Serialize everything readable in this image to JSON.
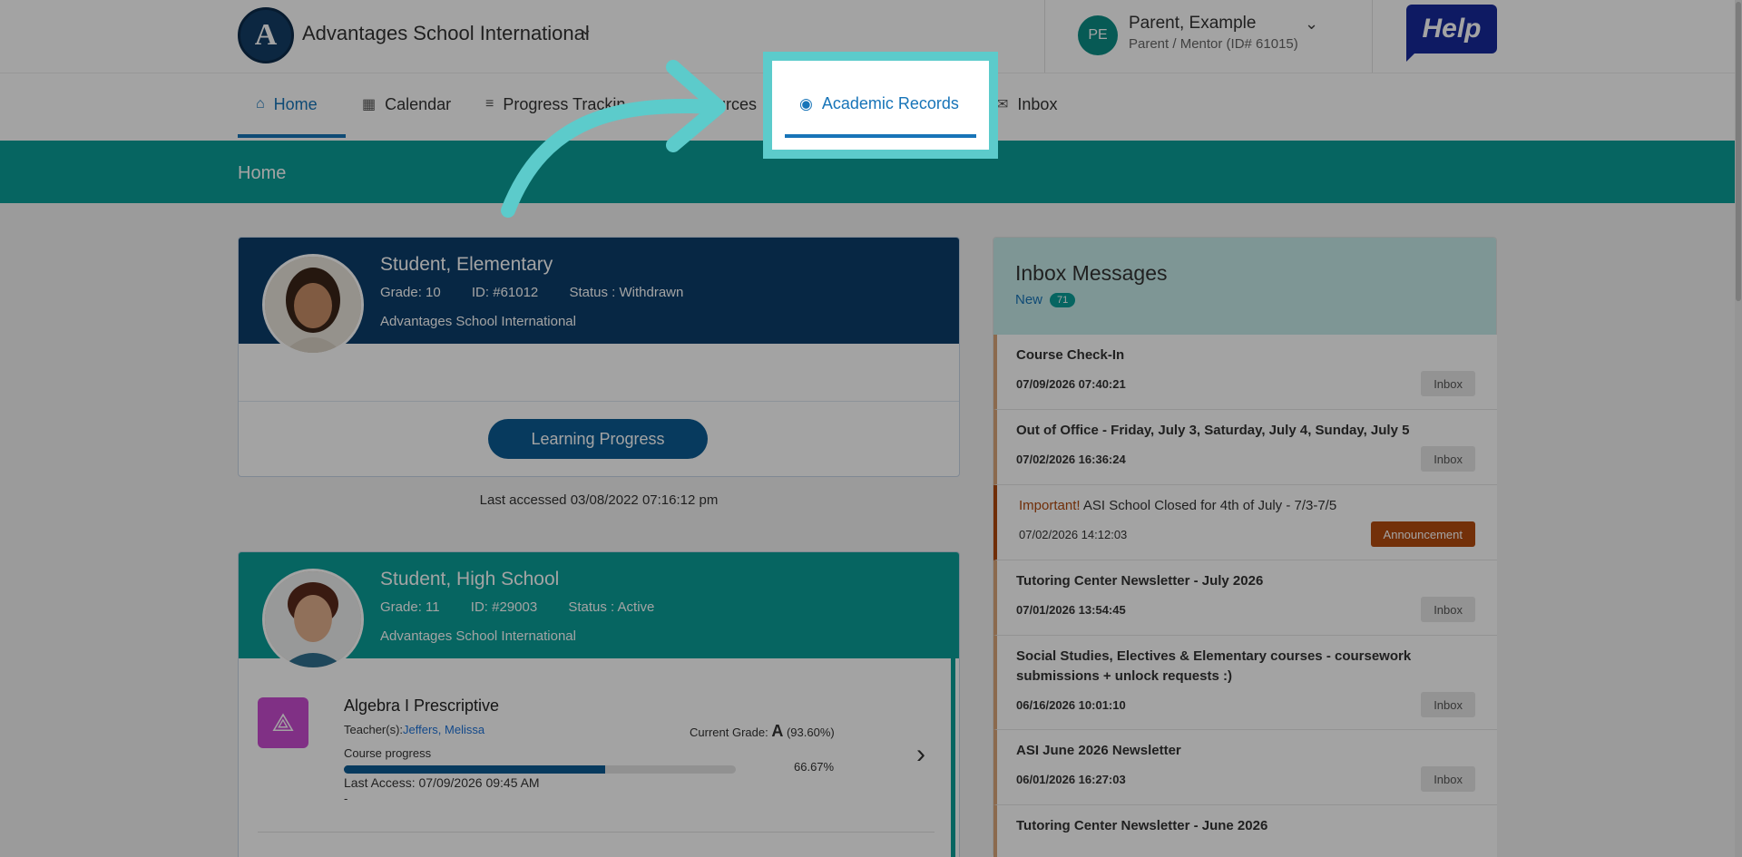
{
  "header": {
    "school_logo_letter": "A",
    "school_name": "Advantages School International",
    "user_initials": "PE",
    "user_name": "Parent, Example",
    "user_role": "Parent / Mentor (ID# 61015)",
    "help_label": "Help"
  },
  "nav": {
    "items": [
      {
        "label": "Home",
        "icon": "home-icon"
      },
      {
        "label": "Calendar",
        "icon": "calendar-icon"
      },
      {
        "label": "Progress Trackin",
        "icon": "progress-icon"
      },
      {
        "label": "ources",
        "icon": ""
      },
      {
        "label": "Academic Records",
        "icon": "user-circle-icon"
      },
      {
        "label": "Inbox",
        "icon": "mail-icon"
      }
    ],
    "active": "Home",
    "highlighted": "Academic Records"
  },
  "banner": {
    "title": "Home"
  },
  "students": [
    {
      "name": "Student, Elementary",
      "grade": "Grade: 10",
      "id": "ID: #61012",
      "status": "Status :  Withdrawn",
      "school": "Advantages School International",
      "header_color": "#0b3d6b",
      "button_label": "Learning Progress",
      "last_accessed": "Last accessed 03/08/2022 07:16:12 pm"
    },
    {
      "name": "Student, High School",
      "grade": "Grade: 11",
      "id": "ID: #29003",
      "status": "Status :  Active",
      "school": "Advantages School International",
      "header_color": "#0a9e98",
      "course": {
        "name": "Algebra I Prescriptive",
        "teacher_label": "Teacher(s):",
        "teacher_name": "Jeffers, Melissa",
        "grade_label": "Current Grade:",
        "grade_letter": "A",
        "grade_pct": "(93.60%)",
        "progress_label": "Course progress",
        "progress_value": 0.6667,
        "progress_text": "66.67%",
        "last_access": "Last Access: 07/09/2026 09:45 AM",
        "dash": "-"
      }
    }
  ],
  "inbox": {
    "title": "Inbox Messages",
    "new_label": "New",
    "new_count": "71",
    "messages": [
      {
        "title": "Course Check-In",
        "date": "07/09/2026 07:40:21",
        "badge": "Inbox"
      },
      {
        "title": "Out of Office - Friday, July 3, Saturday, July 4, Sunday, July 5",
        "date": "07/02/2026 16:36:24",
        "badge": "Inbox"
      },
      {
        "important": "Important!",
        "title": " ASI School Closed for 4th of July - 7/3-7/5",
        "date": "07/02/2026 14:12:03",
        "badge": "Announcement"
      },
      {
        "title": "Tutoring Center Newsletter - July 2026",
        "date": "07/01/2026 13:54:45",
        "badge": "Inbox"
      },
      {
        "title": "Social Studies, Electives & Elementary courses - coursework submissions + unlock requests :)",
        "date": "06/16/2026 10:01:10",
        "badge": "Inbox"
      },
      {
        "title": "ASI June 2026 Newsletter",
        "date": "06/01/2026 16:27:03",
        "badge": "Inbox"
      },
      {
        "title": "Tutoring Center Newsletter - June 2026",
        "date": "",
        "badge": ""
      }
    ]
  },
  "colors": {
    "accent_teal": "#0a9e98",
    "navy": "#0b3d6b",
    "link_blue": "#1774b8",
    "highlight": "#5ccbcb",
    "announcement": "#b54b0f"
  }
}
